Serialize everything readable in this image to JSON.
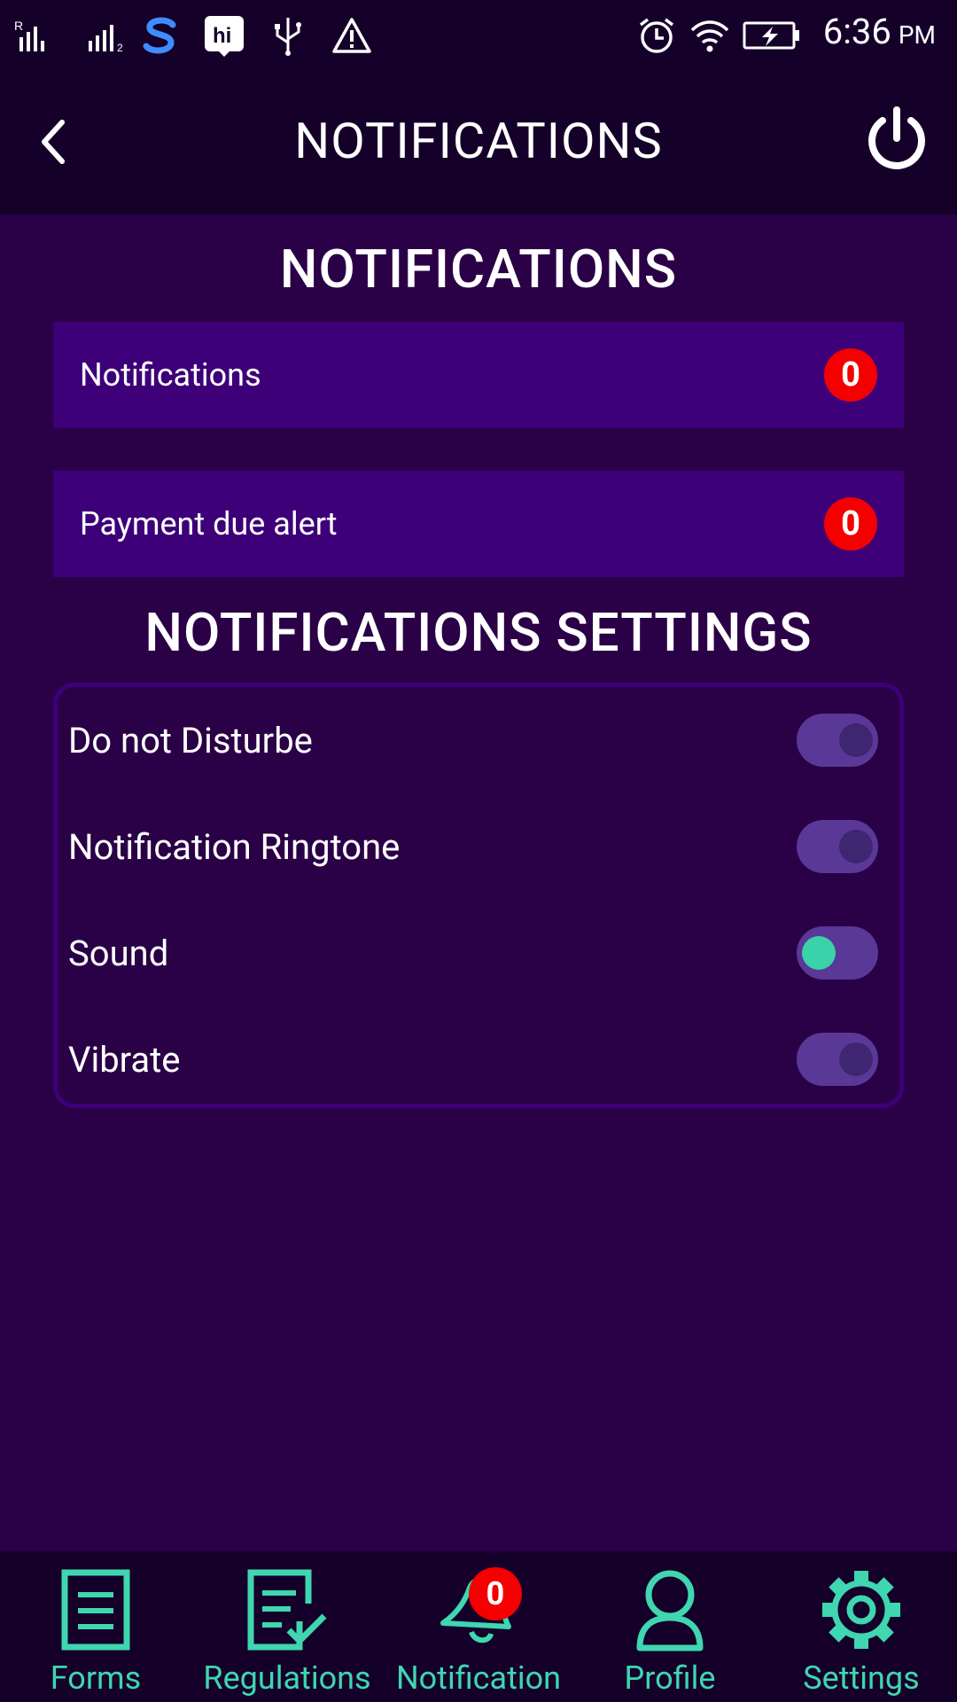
{
  "status_bar": {
    "time": "6:36",
    "ampm": "PM",
    "icons": [
      "signal-r-icon",
      "signal-2-icon",
      "s-app-icon",
      "hi-app-icon",
      "usb-icon",
      "warning-icon",
      "alarm-icon",
      "wifi-icon",
      "battery-charging-icon"
    ]
  },
  "app_bar": {
    "title": "NOTIFICATIONS"
  },
  "section1": {
    "title": "NOTIFICATIONS",
    "items": [
      {
        "label": "Notifications",
        "count": "0"
      },
      {
        "label": "Payment due alert",
        "count": "0"
      }
    ]
  },
  "section2": {
    "title": "NOTIFICATIONS SETTINGS",
    "settings": [
      {
        "label": "Do not Disturbe",
        "on": false
      },
      {
        "label": "Notification Ringtone",
        "on": false
      },
      {
        "label": "Sound",
        "on": true
      },
      {
        "label": "Vibrate",
        "on": false
      }
    ]
  },
  "bottom_nav": {
    "items": [
      {
        "label": "Forms",
        "icon": "form-icon"
      },
      {
        "label": "Regulations",
        "icon": "checklist-icon"
      },
      {
        "label": "Notification",
        "icon": "bell-icon",
        "badge": "0"
      },
      {
        "label": "Profile",
        "icon": "user-icon"
      },
      {
        "label": "Settings",
        "icon": "gear-icon"
      }
    ]
  },
  "colors": {
    "background": "#2a0046",
    "bar": "#15002a",
    "row": "#3d0078",
    "badge": "#f40000",
    "accent": "#3fd6b0",
    "toggle_track": "#5a3898",
    "toggle_on": "#3ad3a9"
  }
}
